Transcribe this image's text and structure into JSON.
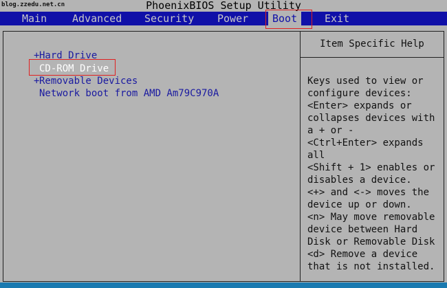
{
  "watermark": "blog.zzedu.net.cn",
  "title": "PhoenixBIOS Setup Utility",
  "menu": [
    {
      "label": "Main"
    },
    {
      "label": "Advanced"
    },
    {
      "label": "Security"
    },
    {
      "label": "Power"
    },
    {
      "label": "Boot",
      "active": true
    },
    {
      "label": "Exit"
    }
  ],
  "boot_list": [
    {
      "prefix": "+",
      "label": "Hard Drive"
    },
    {
      "prefix": "",
      "label": "CD-ROM Drive",
      "selected": true
    },
    {
      "prefix": "+",
      "label": "Removable Devices"
    },
    {
      "prefix": "",
      "label": "Network boot from AMD Am79C970A"
    }
  ],
  "help": {
    "header": "Item Specific Help",
    "lines": [
      "Keys used to view or",
      "configure devices:",
      "<Enter> expands or",
      "collapses devices with",
      "a + or -",
      "<Ctrl+Enter> expands",
      "all",
      "<Shift + 1> enables or",
      "disables a device.",
      "<+> and <-> moves the",
      "device up or down.",
      "<n> May move removable",
      "device between Hard",
      "Disk or Removable Disk",
      "<d> Remove a device",
      "that is not installed."
    ]
  },
  "colors": {
    "menubar_bg": "#1010a8",
    "screen_bg": "#b4b4b4",
    "item_text": "#1a1aa0",
    "selected_text": "#ffffff",
    "highlight_box": "#e02020"
  }
}
